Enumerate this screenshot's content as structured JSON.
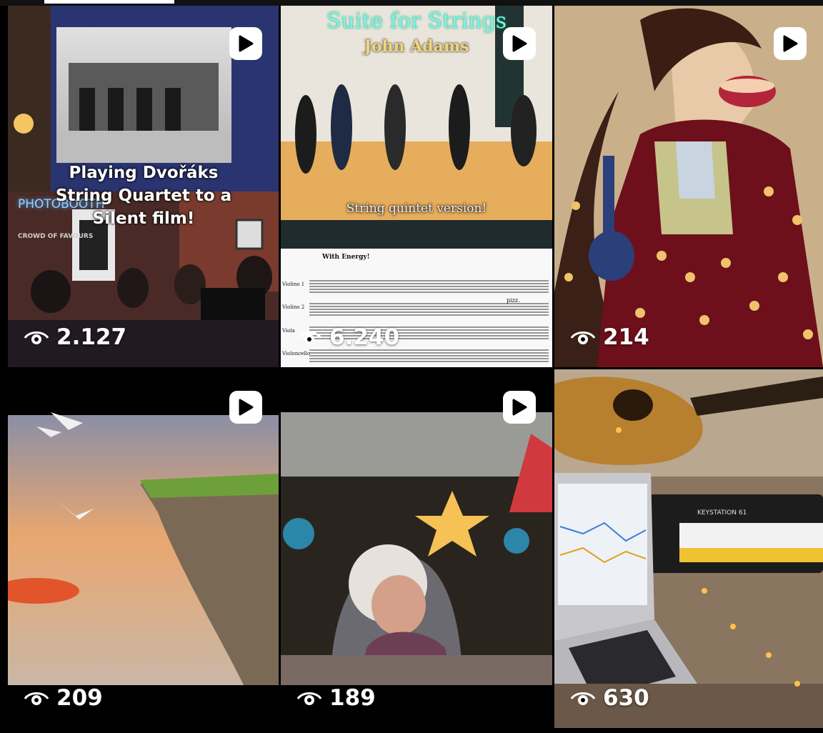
{
  "tiles": [
    {
      "caption": "Playing Dvořáks String Quartet to a Silent film!",
      "sign_text": "PHOTOBOOTH",
      "poster_text": "CROWD OF FAVOURS",
      "views": "2.127",
      "is_video": true
    },
    {
      "title": "Suite for Strings",
      "subtitle": "John Adams",
      "caption": "String quintet version!",
      "score_tempo": "With Energy!",
      "score_parts": [
        "Violino 1",
        "Violino 2",
        "Viola",
        "Violoncello"
      ],
      "score_marking": "pizz.",
      "views": "6.240",
      "is_video": true
    },
    {
      "views": "214",
      "is_video": true
    },
    {
      "views": "209",
      "is_video": true
    },
    {
      "views": "189",
      "is_video": true
    },
    {
      "keyboard_brand": "KEYSTATION 61",
      "views": "630",
      "is_video": false
    }
  ],
  "icons": {
    "play": "play-icon",
    "views": "eye-icon"
  },
  "colors": {
    "background": "#000000",
    "text": "#ffffff",
    "title_cyan": "#7ff0ee",
    "title_gold": "#f2d67a"
  }
}
